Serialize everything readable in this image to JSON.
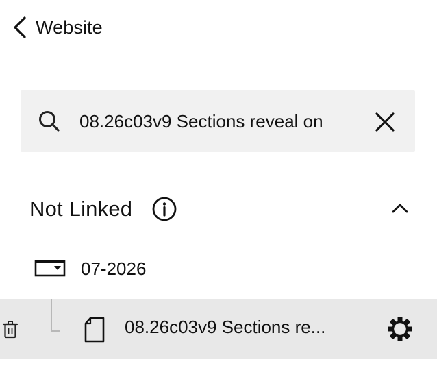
{
  "header": {
    "back_label": "Website",
    "back_icon": "chevron-left-icon"
  },
  "search": {
    "value": "08.26c03v9 Sections reveal on",
    "search_icon": "search-icon",
    "clear_icon": "close-icon"
  },
  "section": {
    "title": "Not Linked",
    "info_icon": "info-circle-icon",
    "collapse_icon": "chevron-up-icon",
    "expanded": true
  },
  "tree": {
    "folder": {
      "label": "07-2026",
      "icon": "folder-dropdown-icon"
    },
    "pages": [
      {
        "label": "08.26c03v9 Sections re...",
        "icon": "page-icon",
        "delete_icon": "trash-icon",
        "settings_icon": "gear-icon",
        "selected": true
      }
    ]
  },
  "colors": {
    "search_background": "#f1f1f1",
    "selected_row_background": "#e8e8e8",
    "text": "#111111",
    "tree_line": "#b8b8b8"
  }
}
